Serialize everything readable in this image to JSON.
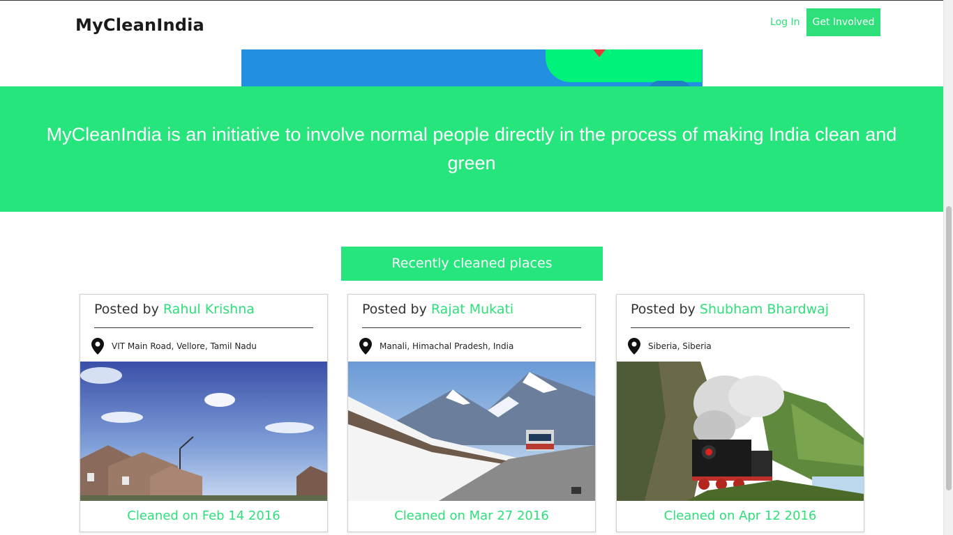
{
  "navbar": {
    "brand": "MyCleanIndia",
    "login_label": "Log In",
    "get_involved_label": "Get Involved"
  },
  "banner": {
    "text": "MyCleanIndia is an initiative to involve normal people directly in the process of making India clean and green"
  },
  "section": {
    "heading": "Recently cleaned places"
  },
  "cards": [
    {
      "posted_prefix": "Posted by ",
      "author": "Rahul Krishna",
      "location": "VIT Main Road, Vellore, Tamil Nadu",
      "photo_icon": "suburban-street-photo",
      "cleaned": "Cleaned on Feb 14 2016"
    },
    {
      "posted_prefix": "Posted by ",
      "author": "Rajat Mukati",
      "location": "Manali, Himachal Pradesh, India",
      "photo_icon": "snowy-mountain-road-photo",
      "cleaned": "Cleaned on Mar 27 2016"
    },
    {
      "posted_prefix": "Posted by ",
      "author": "Shubham Bhardwaj",
      "location": "Siberia, Siberia",
      "photo_icon": "steam-train-photo",
      "cleaned": "Cleaned on Apr 12 2016"
    }
  ],
  "colors": {
    "accent_green": "#26e57c",
    "link_green": "#2ee07a",
    "hero_blue": "#2190e0"
  }
}
